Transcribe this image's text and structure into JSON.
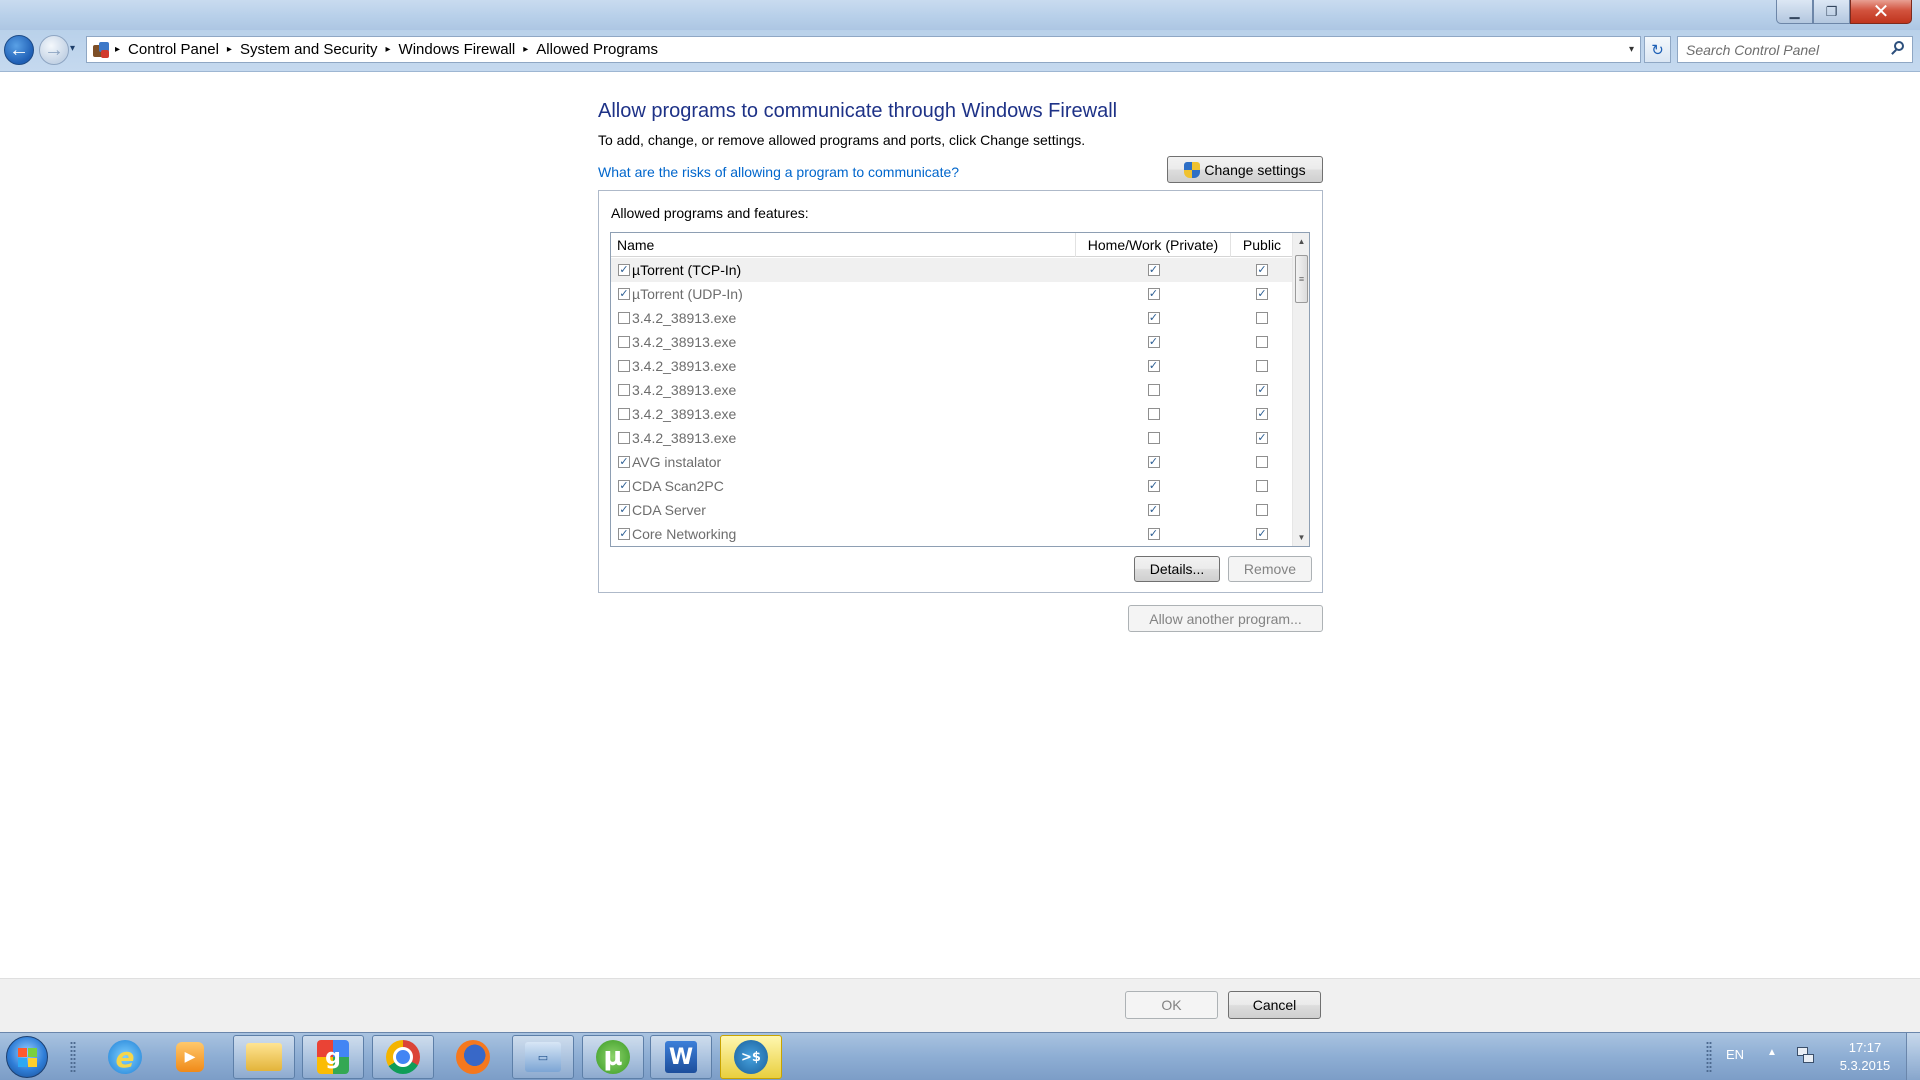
{
  "window": {
    "minimize_icon": "minimize-icon",
    "maximize_icon": "restore-icon",
    "close_icon": "close-icon",
    "minimize_glyph": "▁",
    "maximize_glyph": "❐",
    "close_glyph": "✕"
  },
  "nav": {
    "back_glyph": "←",
    "forward_glyph": "→",
    "history_glyph": "▾",
    "breadcrumbs": [
      "Control Panel",
      "System and Security",
      "Windows Firewall",
      "Allowed Programs"
    ],
    "sep_glyph": "▸",
    "address_dropdown_glyph": "▾",
    "refresh_glyph": "↻",
    "search_placeholder": "Search Control Panel"
  },
  "page": {
    "title": "Allow programs to communicate through Windows Firewall",
    "description": "To add, change, or remove allowed programs and ports, click Change settings.",
    "risk_link": "What are the risks of allowing a program to communicate?",
    "change_settings_label": "Change settings",
    "group_label": "Allowed programs and features:",
    "columns": {
      "name": "Name",
      "home": "Home/Work (Private)",
      "public": "Public"
    },
    "rows": [
      {
        "enabled": true,
        "name": "µTorrent (TCP-In)",
        "home": true,
        "public": true,
        "selected": true
      },
      {
        "enabled": true,
        "name": "µTorrent (UDP-In)",
        "home": true,
        "public": true,
        "selected": false
      },
      {
        "enabled": false,
        "name": "3.4.2_38913.exe",
        "home": true,
        "public": false,
        "selected": false
      },
      {
        "enabled": false,
        "name": "3.4.2_38913.exe",
        "home": true,
        "public": false,
        "selected": false
      },
      {
        "enabled": false,
        "name": "3.4.2_38913.exe",
        "home": true,
        "public": false,
        "selected": false
      },
      {
        "enabled": false,
        "name": "3.4.2_38913.exe",
        "home": false,
        "public": true,
        "selected": false
      },
      {
        "enabled": false,
        "name": "3.4.2_38913.exe",
        "home": false,
        "public": true,
        "selected": false
      },
      {
        "enabled": false,
        "name": "3.4.2_38913.exe",
        "home": false,
        "public": true,
        "selected": false
      },
      {
        "enabled": true,
        "name": "AVG instalator",
        "home": true,
        "public": false,
        "selected": false
      },
      {
        "enabled": true,
        "name": "CDA Scan2PC",
        "home": true,
        "public": false,
        "selected": false
      },
      {
        "enabled": true,
        "name": "CDA Server",
        "home": true,
        "public": false,
        "selected": false
      },
      {
        "enabled": true,
        "name": "Core Networking",
        "home": true,
        "public": true,
        "selected": false
      }
    ],
    "check_glyph": "✓",
    "scroll_up_glyph": "▲",
    "scroll_down_glyph": "▼",
    "scroll_thumb_glyph": "≡",
    "details_label": "Details...",
    "remove_label": "Remove",
    "allow_another_label": "Allow another program..."
  },
  "footer": {
    "ok_label": "OK",
    "cancel_label": "Cancel"
  },
  "taskbar": {
    "apps": [
      {
        "name": "internet-explorer",
        "glyph": "e"
      },
      {
        "name": "media-player",
        "glyph": "▶"
      },
      {
        "name": "file-explorer",
        "glyph": ""
      },
      {
        "name": "google",
        "glyph": "g"
      },
      {
        "name": "chrome",
        "glyph": ""
      },
      {
        "name": "firefox",
        "glyph": ""
      },
      {
        "name": "remote-desktop",
        "glyph": "▭"
      },
      {
        "name": "utorrent",
        "glyph": "µ"
      },
      {
        "name": "word",
        "glyph": "W"
      },
      {
        "name": "powershell",
        "glyph": ">$"
      }
    ],
    "language": "EN",
    "tray_arrow": "▲",
    "time": "17:17",
    "date": "5.3.2015"
  }
}
